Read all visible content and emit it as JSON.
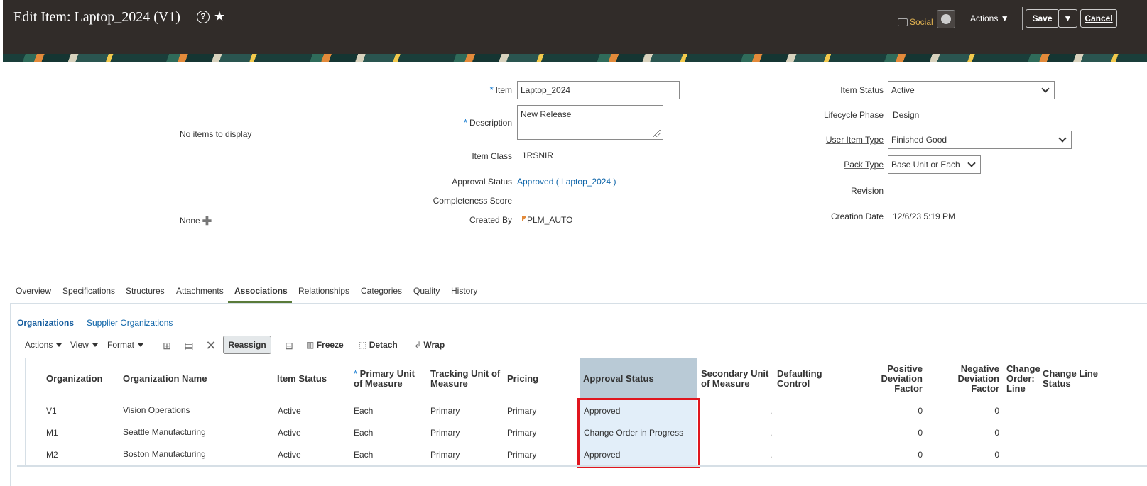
{
  "header": {
    "title": "Edit Item: Laptop_2024 (V1)",
    "social": "Social",
    "actions": "Actions",
    "save": "Save",
    "cancel": "Cancel"
  },
  "form": {
    "item_label": "Item",
    "item_value": "Laptop_2024",
    "description_label": "Description",
    "description_value": "New Release",
    "item_class_label": "Item Class",
    "item_class_value": "1RSNIR",
    "approval_status_label": "Approval Status",
    "approval_status_value": "Approved ( Laptop_2024 )",
    "completeness_label": "Completeness Score",
    "created_by_label": "Created By",
    "created_by_value": "PLM_AUTO",
    "no_items": "No items to display",
    "none": "None",
    "item_status_label": "Item Status",
    "item_status_value": "Active",
    "lifecycle_label": "Lifecycle Phase",
    "lifecycle_value": "Design",
    "user_item_type_label": "User Item Type",
    "user_item_type_value": "Finished Good",
    "pack_type_label": "Pack Type",
    "pack_type_value": "Base Unit or Each",
    "revision_label": "Revision",
    "creation_date_label": "Creation Date",
    "creation_date_value": "12/6/23 5:19 PM"
  },
  "tabs": [
    "Overview",
    "Specifications",
    "Structures",
    "Attachments",
    "Associations",
    "Relationships",
    "Categories",
    "Quality",
    "History"
  ],
  "subtabs": [
    "Organizations",
    "Supplier Organizations"
  ],
  "toolbar": {
    "actions": "Actions",
    "view": "View",
    "format": "Format",
    "reassign": "Reassign",
    "freeze": "Freeze",
    "detach": "Detach",
    "wrap": "Wrap"
  },
  "table": {
    "columns": {
      "organization": "Organization",
      "organization_name": "Organization Name",
      "item_status": "Item Status",
      "primary_uom_1": "Primary Unit",
      "primary_uom_2": "of Measure",
      "tracking_uom_1": "Tracking Unit of",
      "tracking_uom_2": "Measure",
      "pricing": "Pricing",
      "approval_status": "Approval Status",
      "secondary_uom_1": "Secondary Unit",
      "secondary_uom_2": "of Measure",
      "defaulting_1": "Defaulting",
      "defaulting_2": "Control",
      "pos_dev_1": "Positive",
      "pos_dev_2": "Deviation",
      "pos_dev_3": "Factor",
      "neg_dev_1": "Negative",
      "neg_dev_2": "Deviation",
      "neg_dev_3": "Factor",
      "co_line_1": "Change",
      "co_line_2": "Order:",
      "co_line_3": "Line",
      "cl_status_1": "Change Line",
      "cl_status_2": "Status"
    },
    "rows": [
      {
        "org": "V1",
        "name": "Vision Operations",
        "status": "Active",
        "primary": "Each",
        "tracking": "Primary",
        "pricing": "Primary",
        "approval": "Approved",
        "defaulting": ".",
        "pos": "0",
        "neg": "0"
      },
      {
        "org": "M1",
        "name": "Seattle Manufacturing",
        "status": "Active",
        "primary": "Each",
        "tracking": "Primary",
        "pricing": "Primary",
        "approval": "Change Order in Progress",
        "defaulting": ".",
        "pos": "0",
        "neg": "0"
      },
      {
        "org": "M2",
        "name": "Boston Manufacturing",
        "status": "Active",
        "primary": "Each",
        "tracking": "Primary",
        "pricing": "Primary",
        "approval": "Approved",
        "defaulting": ".",
        "pos": "0",
        "neg": "0"
      }
    ]
  },
  "colors": {
    "header_bg": "#312c29",
    "link": "#0b63a8",
    "highlight": "#e0161e",
    "approval_column_bg": "#e2eef9"
  }
}
